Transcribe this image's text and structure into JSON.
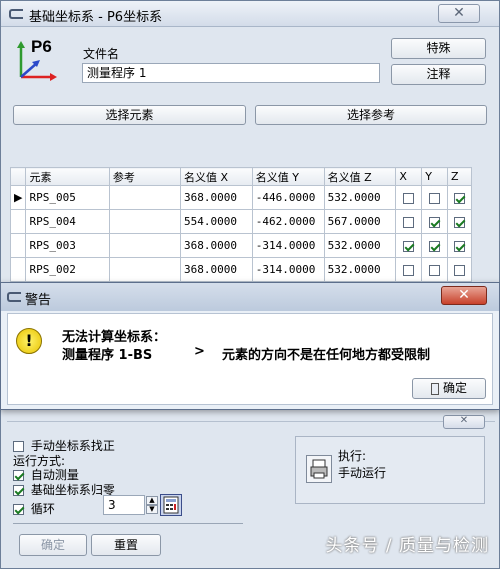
{
  "window": {
    "title": "基础坐标系 - P6坐标系"
  },
  "logo": {
    "text": "P6"
  },
  "file": {
    "label": "文件名",
    "value": "测量程序 1"
  },
  "buttons": {
    "special": "特殊",
    "comment": "注释",
    "select_elements": "选择元素",
    "select_reference": "选择参考"
  },
  "table": {
    "headers": [
      "元素",
      "参考",
      "名义值 X",
      "名义值 Y",
      "名义值 Z",
      "X",
      "Y",
      "Z"
    ],
    "rows": [
      {
        "element": "RPS_005",
        "reference": "",
        "x": "368.0000",
        "y": "-446.0000",
        "z": "532.0000",
        "cx": false,
        "cy": false,
        "cz": true,
        "current": true
      },
      {
        "element": "RPS_004",
        "reference": "",
        "x": "554.0000",
        "y": "-462.0000",
        "z": "567.0000",
        "cx": false,
        "cy": true,
        "cz": true,
        "current": false
      },
      {
        "element": "RPS_003",
        "reference": "",
        "x": "368.0000",
        "y": "-314.0000",
        "z": "532.0000",
        "cx": true,
        "cy": true,
        "cz": true,
        "current": false
      },
      {
        "element": "RPS_002",
        "reference": "",
        "x": "368.0000",
        "y": "-314.0000",
        "z": "532.0000",
        "cx": false,
        "cy": false,
        "cz": false,
        "current": false
      }
    ]
  },
  "dialog": {
    "title": "警告",
    "line1": "无法计算坐标系：",
    "line2_left": "测量程序 1-BS",
    "line2_arrow": ">",
    "line2_right": "元素的方向不是在任何地方都受限制",
    "ok": "确定",
    "icon": "warning-icon"
  },
  "bottom": {
    "manual_align": {
      "label": "手动坐标系找正",
      "checked": false
    },
    "run_mode_label": "运行方式:",
    "auto_measure": {
      "label": "自动测量",
      "checked": true
    },
    "zero_base": {
      "label": "基础坐标系归零",
      "checked": true
    },
    "loop": {
      "label": "循环",
      "checked": true,
      "value": "3"
    },
    "execute_label": "执行:",
    "execute_value": "手动运行",
    "ok": "确定",
    "reset": "重置"
  },
  "watermark": "头条号 / 质量与检测"
}
